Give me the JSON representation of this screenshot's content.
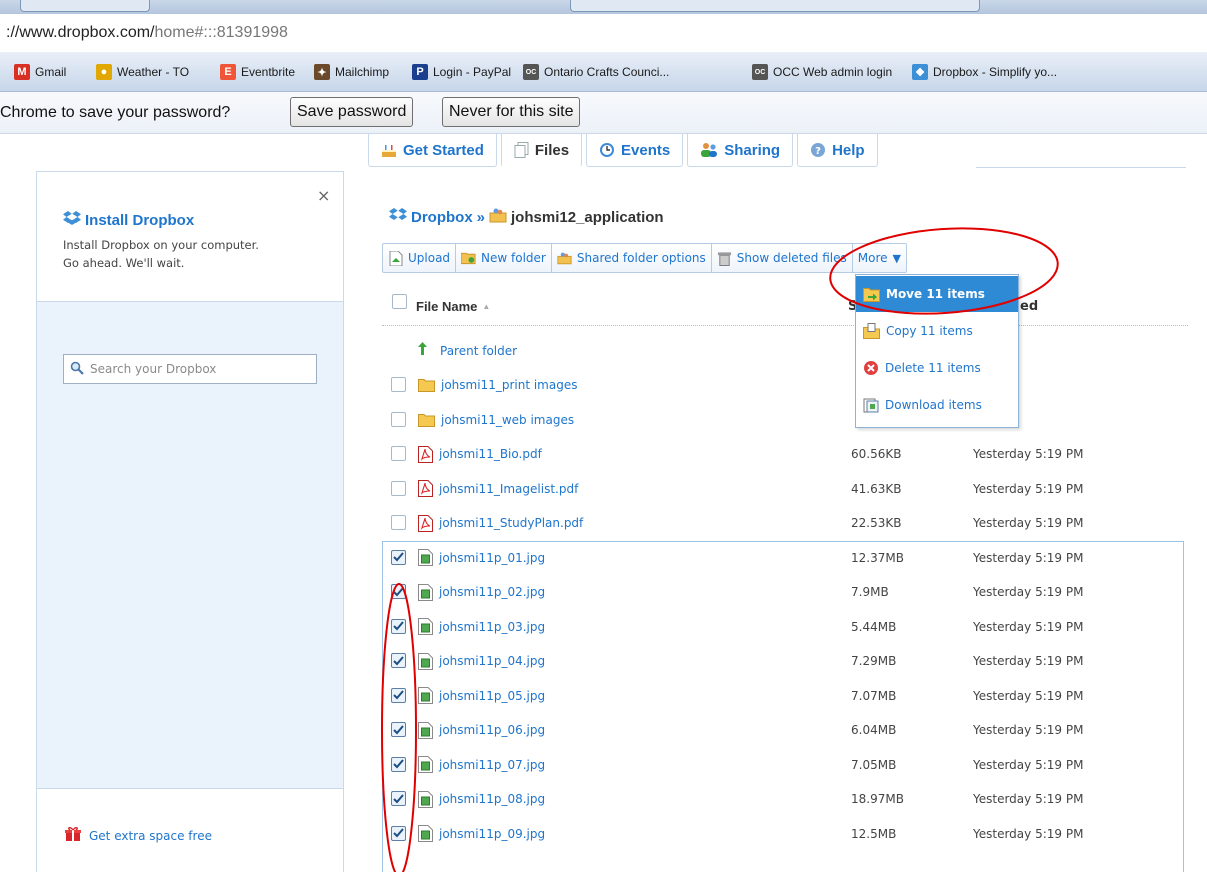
{
  "browser": {
    "url_partial": "://www.dropbox.com/",
    "url_rest": "home#:::81391998",
    "bookmarks": [
      {
        "label": "Gmail",
        "icon": "gmail-icon",
        "color": "#d93025",
        "glyph": "M"
      },
      {
        "label": "Weather - TO",
        "icon": "weather-icon",
        "color": "#e0a800",
        "glyph": "●"
      },
      {
        "label": "Eventbrite",
        "icon": "eventbrite-icon",
        "color": "#f05537",
        "glyph": "E"
      },
      {
        "label": "Mailchimp",
        "icon": "mailchimp-icon",
        "color": "#6b4a2b",
        "glyph": "✦"
      },
      {
        "label": "Login - PayPal",
        "icon": "paypal-icon",
        "color": "#1b3f8f",
        "glyph": "P"
      },
      {
        "label": "Ontario Crafts Counci...",
        "icon": "occ-icon",
        "color": "#555555",
        "glyph": "OC"
      },
      {
        "label": "OCC Web admin login",
        "icon": "occ-icon",
        "color": "#555555",
        "glyph": "OC"
      },
      {
        "label": "Dropbox - Simplify yo...",
        "icon": "dropbox-icon",
        "color": "#3d8fd6",
        "glyph": "❖"
      }
    ],
    "infobar": {
      "text": "Chrome to save your password?",
      "save_label": "Save password",
      "never_label": "Never for this site"
    }
  },
  "tabs": [
    {
      "label": "Get Started",
      "icon": "cake-icon",
      "active": false
    },
    {
      "label": "Files",
      "icon": "files-icon",
      "active": true
    },
    {
      "label": "Events",
      "icon": "clock-icon",
      "active": false
    },
    {
      "label": "Sharing",
      "icon": "people-icon",
      "active": false
    },
    {
      "label": "Help",
      "icon": "help-icon",
      "active": false
    }
  ],
  "sidebar": {
    "install_title": "Install Dropbox",
    "install_desc_1": "Install Dropbox on your computer.",
    "install_desc_2": "Go ahead. We'll wait.",
    "close": "×",
    "search_placeholder": "Search your Dropbox",
    "extra_space": "Get extra space free"
  },
  "breadcrumb": {
    "root": "Dropbox",
    "separator": "»",
    "folder": "johsmi12_application"
  },
  "toolbar": {
    "upload": "Upload",
    "new_folder": "New folder",
    "shared_options": "Shared folder options",
    "show_deleted": "Show deleted files",
    "more": "More"
  },
  "list_header": {
    "name": "File Name",
    "sort_arrow": "▲",
    "size_stub": "S",
    "modified_stub": "ed"
  },
  "parent_folder": "Parent folder",
  "files": [
    {
      "name": "johsmi11_print images",
      "type": "folder",
      "size": "",
      "modified": "",
      "checked": false
    },
    {
      "name": "johsmi11_web images",
      "type": "folder",
      "size": "",
      "modified": "",
      "checked": false
    },
    {
      "name": "johsmi11_Bio.pdf",
      "type": "pdf",
      "size": "60.56KB",
      "modified": "Yesterday 5:19 PM",
      "checked": false
    },
    {
      "name": "johsmi11_Imagelist.pdf",
      "type": "pdf",
      "size": "41.63KB",
      "modified": "Yesterday 5:19 PM",
      "checked": false
    },
    {
      "name": "johsmi11_StudyPlan.pdf",
      "type": "pdf",
      "size": "22.53KB",
      "modified": "Yesterday 5:19 PM",
      "checked": false
    },
    {
      "name": "johsmi11p_01.jpg",
      "type": "image",
      "size": "12.37MB",
      "modified": "Yesterday 5:19 PM",
      "checked": true
    },
    {
      "name": "johsmi11p_02.jpg",
      "type": "image",
      "size": "7.9MB",
      "modified": "Yesterday 5:19 PM",
      "checked": true
    },
    {
      "name": "johsmi11p_03.jpg",
      "type": "image",
      "size": "5.44MB",
      "modified": "Yesterday 5:19 PM",
      "checked": true
    },
    {
      "name": "johsmi11p_04.jpg",
      "type": "image",
      "size": "7.29MB",
      "modified": "Yesterday 5:19 PM",
      "checked": true
    },
    {
      "name": "johsmi11p_05.jpg",
      "type": "image",
      "size": "7.07MB",
      "modified": "Yesterday 5:19 PM",
      "checked": true
    },
    {
      "name": "johsmi11p_06.jpg",
      "type": "image",
      "size": "6.04MB",
      "modified": "Yesterday 5:19 PM",
      "checked": true
    },
    {
      "name": "johsmi11p_07.jpg",
      "type": "image",
      "size": "7.05MB",
      "modified": "Yesterday 5:19 PM",
      "checked": true
    },
    {
      "name": "johsmi11p_08.jpg",
      "type": "image",
      "size": "18.97MB",
      "modified": "Yesterday 5:19 PM",
      "checked": true
    },
    {
      "name": "johsmi11p_09.jpg",
      "type": "image",
      "size": "12.5MB",
      "modified": "Yesterday 5:19 PM",
      "checked": true
    }
  ],
  "more_menu": [
    {
      "label": "Move 11 items",
      "icon": "move-icon",
      "highlighted": true
    },
    {
      "label": "Copy 11 items",
      "icon": "copy-icon",
      "highlighted": false
    },
    {
      "label": "Delete 11 items",
      "icon": "delete-icon",
      "highlighted": false
    },
    {
      "label": "Download items",
      "icon": "download-icon",
      "highlighted": false
    }
  ],
  "colors": {
    "link_blue": "#1f75cc",
    "menu_highlight": "#2f8ad6",
    "annotation_red": "#e00000"
  }
}
